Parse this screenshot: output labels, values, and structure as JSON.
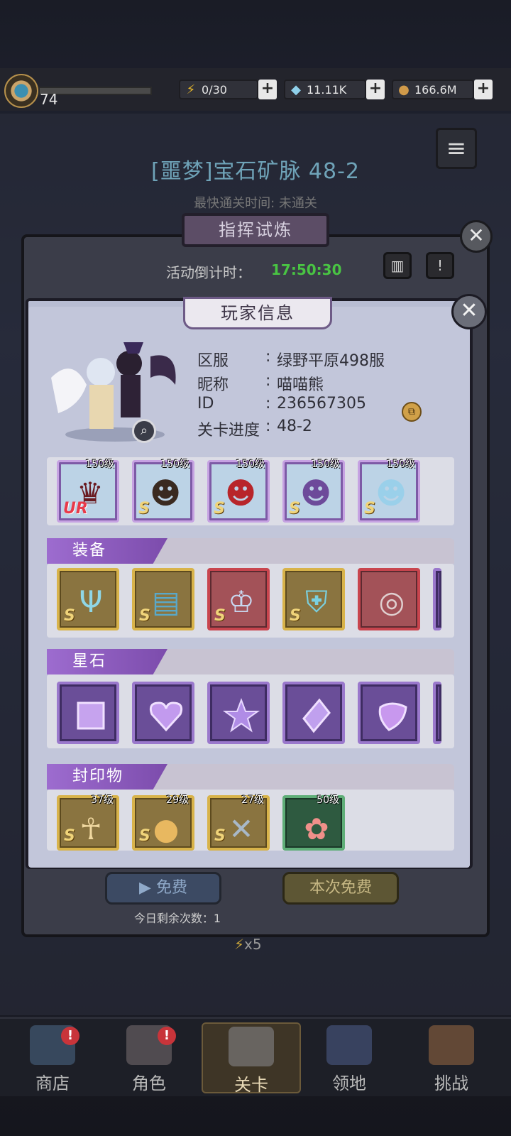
{
  "topbar": {
    "level": "74",
    "energy": "0/30",
    "gems": "11.11K",
    "gold": "166.6M"
  },
  "stage": {
    "title": "[噩梦]宝石矿脉 48-2",
    "fastest": "最快通关时间:  未通关"
  },
  "trial": {
    "title": "指挥试炼",
    "countdown_label": "活动倒计时：",
    "countdown_value": "17:50:30",
    "free_label": "免费",
    "free_this_label": "本次免费",
    "remaining": "今日剩余次数：1",
    "multiplier": "x5"
  },
  "player": {
    "title": "玩家信息",
    "server_key": "区服",
    "server_val": "绿野平原498服",
    "nick_key": "昵称",
    "nick_val": "喵喵熊",
    "id_key": "ID",
    "id_val": "236567305",
    "progress_key": "关卡进度",
    "progress_val": "48-2"
  },
  "heroes": [
    {
      "level": "150级",
      "rank": "UR"
    },
    {
      "level": "150级",
      "rank": "S"
    },
    {
      "level": "150级",
      "rank": "S"
    },
    {
      "level": "150级",
      "rank": "S"
    },
    {
      "level": "150级",
      "rank": "S"
    }
  ],
  "equipment": {
    "title": "装备",
    "items": [
      {
        "icon": "trident-icon",
        "rank": "S",
        "frame": "gold"
      },
      {
        "icon": "book-icon",
        "rank": "S",
        "frame": "gold"
      },
      {
        "icon": "crown-icon",
        "rank": "S",
        "frame": "red"
      },
      {
        "icon": "armor-icon",
        "rank": "S",
        "frame": "gold"
      },
      {
        "icon": "ring-icon",
        "rank": "",
        "frame": "red"
      }
    ]
  },
  "starstones": {
    "title": "星石",
    "items": [
      "square-gem-icon",
      "heart-gem-icon",
      "star-gem-icon",
      "diamond-gem-icon",
      "drop-gem-icon"
    ]
  },
  "seals": {
    "title": "封印物",
    "items": [
      {
        "level": "37级",
        "rank": "S",
        "icon": "puppet-icon",
        "frame": "gold"
      },
      {
        "level": "29级",
        "rank": "S",
        "icon": "coin-icon",
        "frame": "gold"
      },
      {
        "level": "27级",
        "rank": "S",
        "icon": "cutlery-icon",
        "frame": "gold"
      },
      {
        "level": "50级",
        "rank": "",
        "icon": "flower-icon",
        "frame": "green"
      }
    ]
  },
  "nav": {
    "shop": "商店",
    "hero": "角色",
    "stage": "关卡",
    "territory": "领地",
    "challenge": "挑战"
  },
  "colors": {
    "countdown": "#49c443",
    "accent_purple": "#9d6ccf",
    "rank_gold": "#f0d47a"
  }
}
